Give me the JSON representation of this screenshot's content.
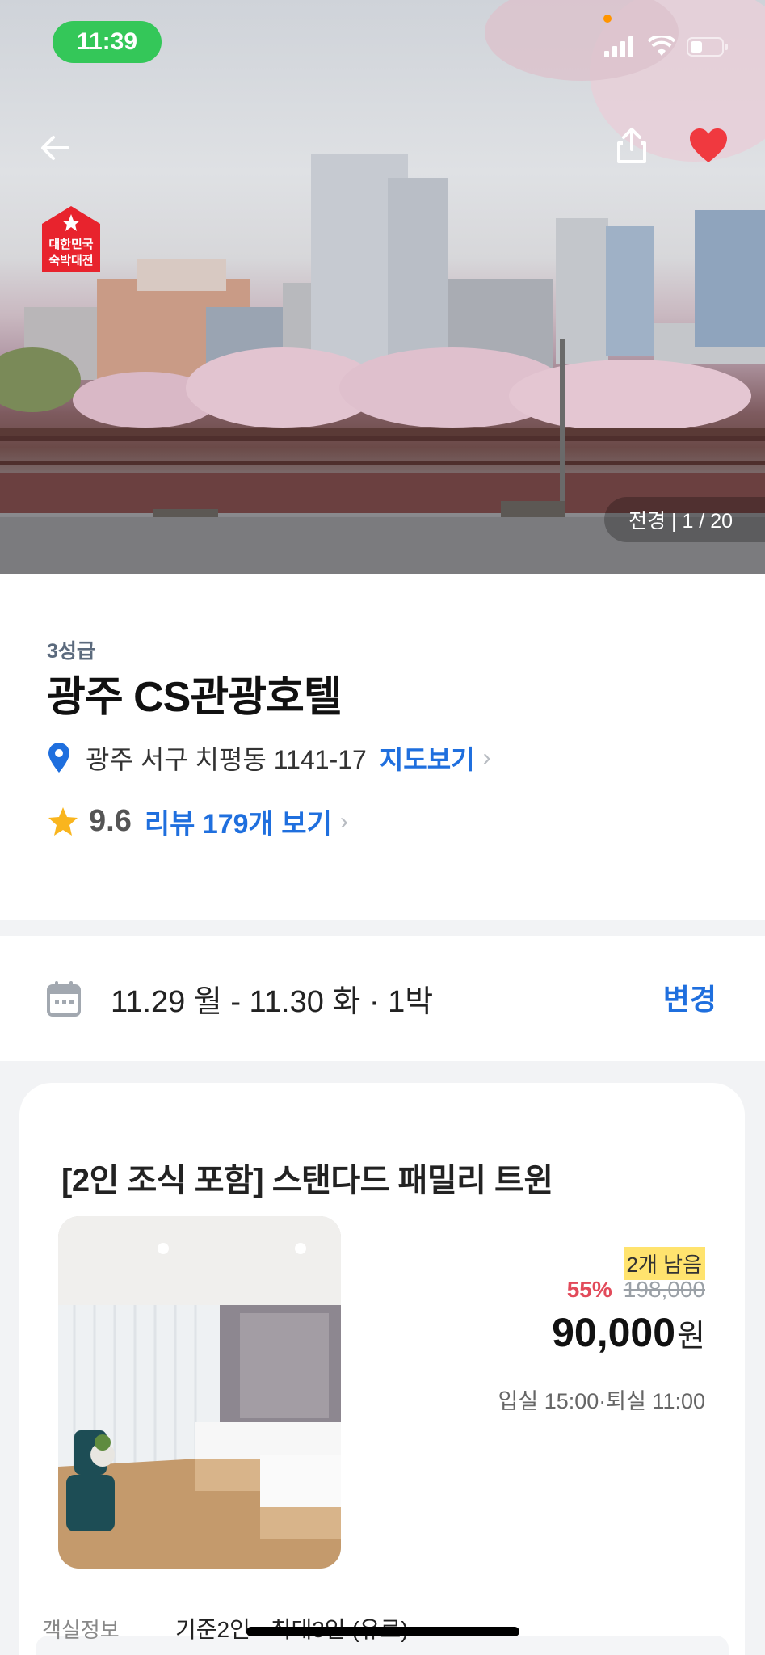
{
  "status_bar": {
    "time": "11:39"
  },
  "hero": {
    "photo_counter": "전경 | 1 / 20",
    "badge_line1": "대한민국",
    "badge_line2": "숙박대전"
  },
  "hotel": {
    "grade": "3성급",
    "name": "광주 CS관광호텔",
    "address": "광주 서구 치평동 1141-17",
    "map_link": "지도보기",
    "rating": "9.6",
    "review_link": "리뷰 179개 보기"
  },
  "booking": {
    "dates": "11.29 월 - 11.30 화 · 1박",
    "change_label": "변경"
  },
  "room": {
    "title": "[2인 조식 포함] 스탠다드 패밀리 트윈",
    "remaining": "2개 남음",
    "discount": "55%",
    "original_price": "198,000",
    "price": "90,000",
    "currency": "원",
    "checkin": "입실 15:00·퇴실 11:00",
    "info_label": "객실정보",
    "info_value": "기준2인 · 최대3인 (유료)"
  },
  "colors": {
    "accent": "#1f6fde",
    "discount": "#e24a5a",
    "status_green": "#34c759",
    "heart": "#f0393f"
  },
  "icons": [
    "back-arrow-icon",
    "share-icon",
    "heart-icon",
    "location-pin-icon",
    "star-icon",
    "calendar-icon",
    "signal-icon",
    "wifi-icon",
    "battery-icon"
  ]
}
